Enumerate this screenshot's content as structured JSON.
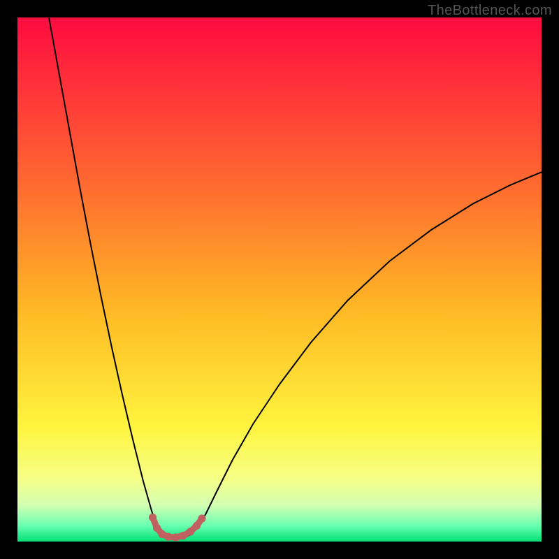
{
  "watermark": "TheBottleneck.com",
  "chart_data": {
    "type": "line",
    "title": "",
    "xlabel": "",
    "ylabel": "",
    "xlim": [
      0,
      1
    ],
    "ylim": [
      0,
      100
    ],
    "legend": false,
    "grid": false,
    "background_gradient": {
      "stops": [
        {
          "offset": 0.0,
          "color": "#ff0b40"
        },
        {
          "offset": 0.32,
          "color": "#ff6a30"
        },
        {
          "offset": 0.56,
          "color": "#ffb925"
        },
        {
          "offset": 0.78,
          "color": "#fff43e"
        },
        {
          "offset": 0.88,
          "color": "#f6ff86"
        },
        {
          "offset": 0.93,
          "color": "#d4ffb3"
        },
        {
          "offset": 0.97,
          "color": "#68ffb0"
        },
        {
          "offset": 1.0,
          "color": "#02e077"
        }
      ]
    },
    "series": [
      {
        "name": "curve",
        "stroke": "#000000",
        "stroke_width": 2.0,
        "points": [
          {
            "x": 0.06,
            "y": 100.0
          },
          {
            "x": 0.08,
            "y": 89.0
          },
          {
            "x": 0.1,
            "y": 78.0
          },
          {
            "x": 0.12,
            "y": 67.0
          },
          {
            "x": 0.14,
            "y": 56.5
          },
          {
            "x": 0.16,
            "y": 46.5
          },
          {
            "x": 0.18,
            "y": 37.0
          },
          {
            "x": 0.2,
            "y": 28.0
          },
          {
            "x": 0.22,
            "y": 19.5
          },
          {
            "x": 0.24,
            "y": 11.5
          },
          {
            "x": 0.255,
            "y": 6.2
          },
          {
            "x": 0.265,
            "y": 3.0
          },
          {
            "x": 0.275,
            "y": 1.2
          },
          {
            "x": 0.285,
            "y": 0.5
          },
          {
            "x": 0.3,
            "y": 0.4
          },
          {
            "x": 0.315,
            "y": 0.6
          },
          {
            "x": 0.33,
            "y": 1.3
          },
          {
            "x": 0.345,
            "y": 2.8
          },
          {
            "x": 0.36,
            "y": 5.4
          },
          {
            "x": 0.38,
            "y": 9.5
          },
          {
            "x": 0.41,
            "y": 15.5
          },
          {
            "x": 0.45,
            "y": 22.5
          },
          {
            "x": 0.5,
            "y": 30.0
          },
          {
            "x": 0.56,
            "y": 38.0
          },
          {
            "x": 0.63,
            "y": 46.0
          },
          {
            "x": 0.71,
            "y": 53.5
          },
          {
            "x": 0.79,
            "y": 59.5
          },
          {
            "x": 0.87,
            "y": 64.5
          },
          {
            "x": 0.94,
            "y": 68.0
          },
          {
            "x": 1.0,
            "y": 70.5
          }
        ]
      },
      {
        "name": "sweet-spot-marker",
        "stroke": "#c06060",
        "stroke_width": 9.0,
        "linecap": "round",
        "points": [
          {
            "x": 0.258,
            "y": 4.6
          },
          {
            "x": 0.266,
            "y": 2.6
          },
          {
            "x": 0.276,
            "y": 1.4
          },
          {
            "x": 0.288,
            "y": 0.9
          },
          {
            "x": 0.302,
            "y": 0.8
          },
          {
            "x": 0.316,
            "y": 1.1
          },
          {
            "x": 0.33,
            "y": 1.9
          },
          {
            "x": 0.342,
            "y": 3.0
          },
          {
            "x": 0.352,
            "y": 4.4
          }
        ]
      }
    ]
  }
}
